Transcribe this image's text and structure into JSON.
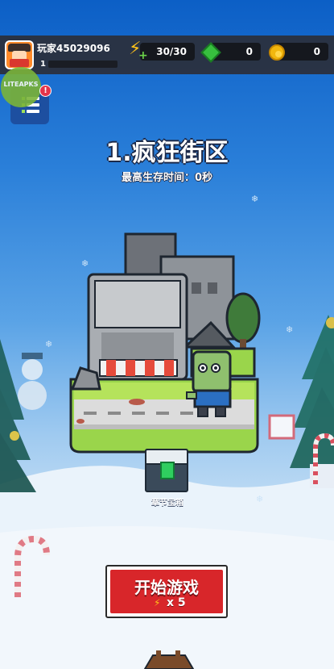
{
  "header": {
    "player_name": "玩家45029096",
    "player_level": "1",
    "energy": "30/30",
    "gems": "0",
    "coins": "0"
  },
  "watermark": "LITEAPKS",
  "quest": {
    "badge": "!"
  },
  "stage": {
    "title": "1.疯狂街区",
    "best_survival": "最高生存时间：0秒"
  },
  "chest": {
    "label": "章节宝箱"
  },
  "start": {
    "label": "开始游戏",
    "cost": "x 5"
  },
  "colors": {
    "accent_red": "#d8262a",
    "gem_green": "#37c03e",
    "coin_gold": "#f2b70e",
    "energy_yellow": "#ffc21a"
  }
}
